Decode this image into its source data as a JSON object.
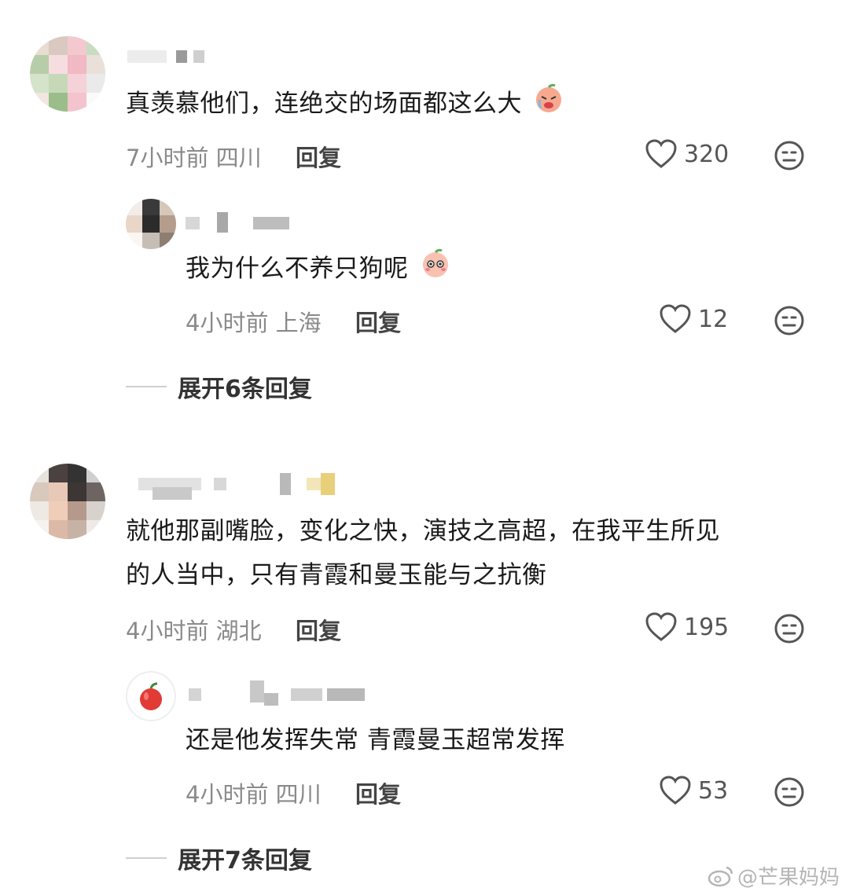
{
  "comments": [
    {
      "text": "真羡慕他们，连绝交的场面都这么大",
      "time": "7小时前",
      "location": "四川",
      "reply_label": "回复",
      "likes": "320",
      "reply": {
        "text": "我为什么不养只狗呢",
        "time": "4小时前",
        "location": "上海",
        "reply_label": "回复",
        "likes": "12"
      },
      "expand_label": "展开6条回复"
    },
    {
      "text_line1": "就他那副嘴脸，变化之快，演技之高超，在我平生所见",
      "text_line2": "的人当中，只有青霞和曼玉能与之抗衡",
      "time": "4小时前",
      "location": "湖北",
      "reply_label": "回复",
      "likes": "195",
      "reply": {
        "text": "还是他发挥失常 青霞曼玉超常发挥",
        "time": "4小时前",
        "location": "四川",
        "reply_label": "回复",
        "likes": "53"
      },
      "expand_label": "展开7条回复"
    }
  ],
  "watermark": "@芒果妈妈",
  "icons": {
    "like": "heart-outline-icon",
    "dislike": "neutral-face-icon",
    "emoji1": "crying-peach-emoji",
    "emoji2": "shy-peach-emoji"
  }
}
